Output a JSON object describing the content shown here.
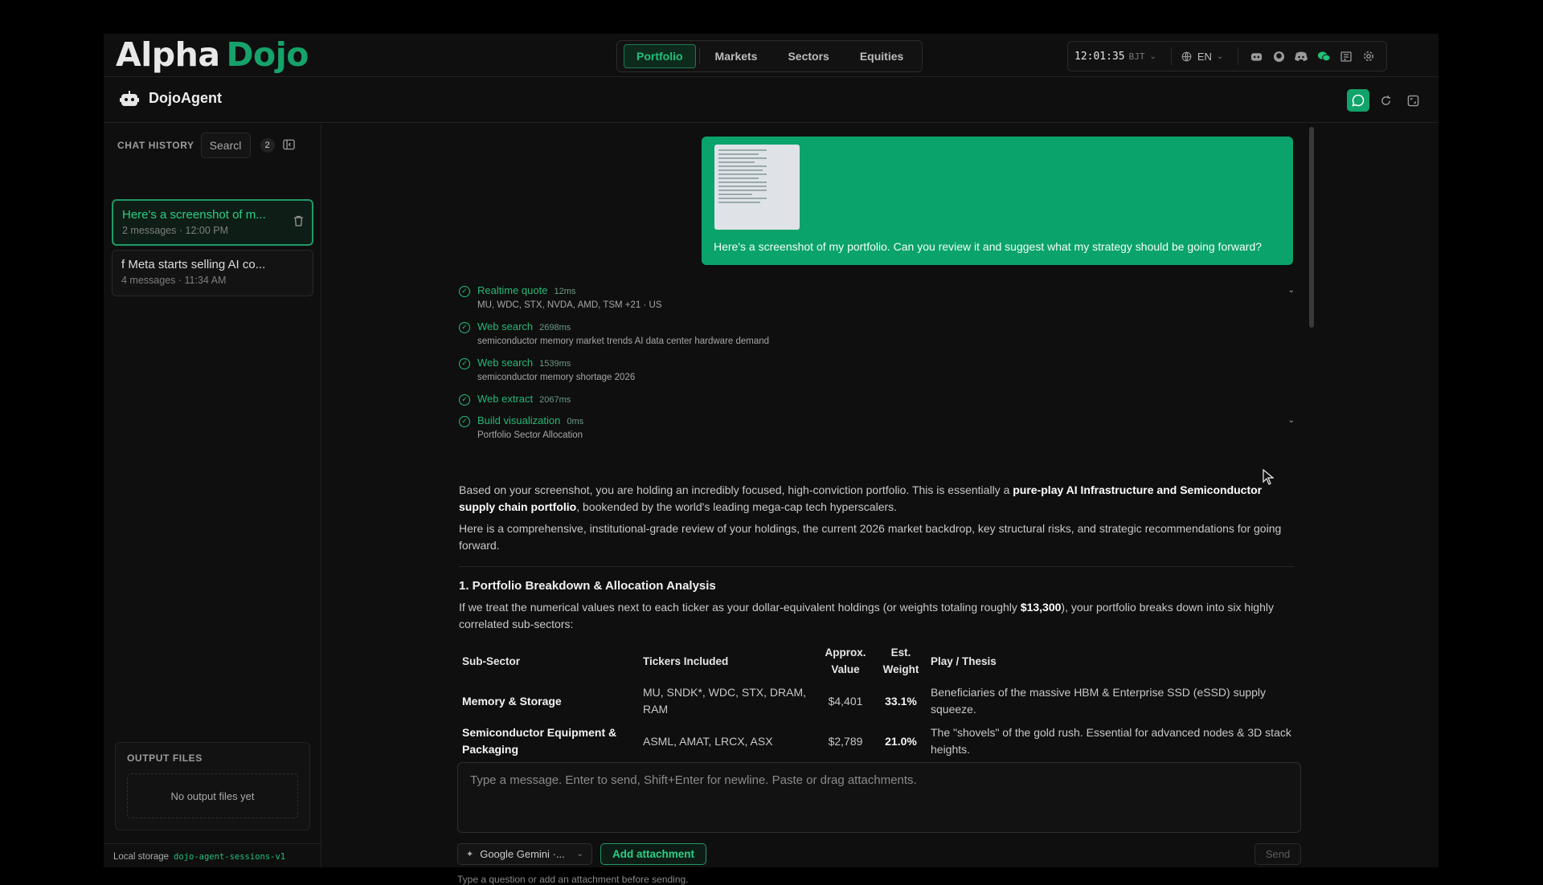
{
  "app": {
    "logo_part1": "Alpha",
    "logo_part2": "Dojo"
  },
  "nav": {
    "tabs": [
      {
        "label": "Portfolio"
      },
      {
        "label": "Markets"
      },
      {
        "label": "Sectors"
      },
      {
        "label": "Equities"
      }
    ]
  },
  "header_right": {
    "time": "12:01:35",
    "timezone": "BJT",
    "language": "EN"
  },
  "agent": {
    "title": "DojoAgent"
  },
  "sidebar": {
    "history_label": "CHAT HISTORY",
    "search_value": "Searcl",
    "count": "2",
    "chats": [
      {
        "title": "Here's a screenshot of m...",
        "meta_count": "2 messages",
        "meta_time": "12:00 PM"
      },
      {
        "title": "f Meta starts selling AI co...",
        "meta_count": "4 messages",
        "meta_time": "11:34 AM"
      }
    ],
    "output_label": "OUTPUT FILES",
    "output_empty": "No output files yet",
    "storage_label": "Local storage",
    "storage_key": "dojo-agent-sessions-v1"
  },
  "conversation": {
    "user_message": "Here's a screenshot of my portfolio. Can you review it and suggest what my strategy should be going forward?",
    "tools": [
      {
        "name": "Realtime quote",
        "ms": "12ms",
        "desc": "MU, WDC, STX, NVDA, AMD, TSM +21 · US",
        "caret": true
      },
      {
        "name": "Web search",
        "ms": "2698ms",
        "desc": "semiconductor memory market trends AI data center hardware demand",
        "caret": false
      },
      {
        "name": "Web search",
        "ms": "1539ms",
        "desc": "semiconductor memory shortage 2026",
        "caret": false
      },
      {
        "name": "Web extract",
        "ms": "2067ms",
        "desc": "",
        "caret": false
      },
      {
        "name": "Build visualization",
        "ms": "0ms",
        "desc": "Portfolio Sector Allocation",
        "caret": true
      }
    ],
    "p1_a": "Based on your screenshot, you are holding an incredibly focused, high-conviction portfolio. This is essentially a ",
    "p1_b": "pure-play AI Infrastructure and Semiconductor supply chain portfolio",
    "p1_c": ", bookended by the world's leading mega-cap tech hyperscalers.",
    "p2": "Here is a comprehensive, institutional-grade review of your holdings, the current 2026 market backdrop, key structural risks, and strategic recommendations for going forward.",
    "h1": "1. Portfolio Breakdown & Allocation Analysis",
    "p3_a": "If we treat the numerical values next to each ticker as your dollar-equivalent holdings (or weights totaling roughly ",
    "p3_b": "$13,300",
    "p3_c": "), your portfolio breaks down into six highly correlated sub-sectors:",
    "table": {
      "headers": [
        "Sub-Sector",
        "Tickers Included",
        "Approx. Value",
        "Est. Weight",
        "Play / Thesis"
      ],
      "rows": [
        [
          "Memory & Storage",
          "MU, SNDK*, WDC, STX, DRAM, RAM",
          "$4,401",
          "33.1%",
          "Beneficiaries of the massive HBM & Enterprise SSD (eSSD) supply squeeze."
        ],
        [
          "Semiconductor Equipment & Packaging",
          "ASML, AMAT, LRCX, ASX",
          "$2,789",
          "21.0%",
          "The \"shovels\" of the gold rush. Essential for advanced nodes & 3D stack heights."
        ]
      ]
    }
  },
  "composer": {
    "placeholder": "Type a message. Enter to send, Shift+Enter for newline. Paste or drag attachments.",
    "model": "Google Gemini ·...",
    "attach_label": "Add attachment",
    "send_label": "Send",
    "hint": "Type a question or add an attachment before sending."
  }
}
